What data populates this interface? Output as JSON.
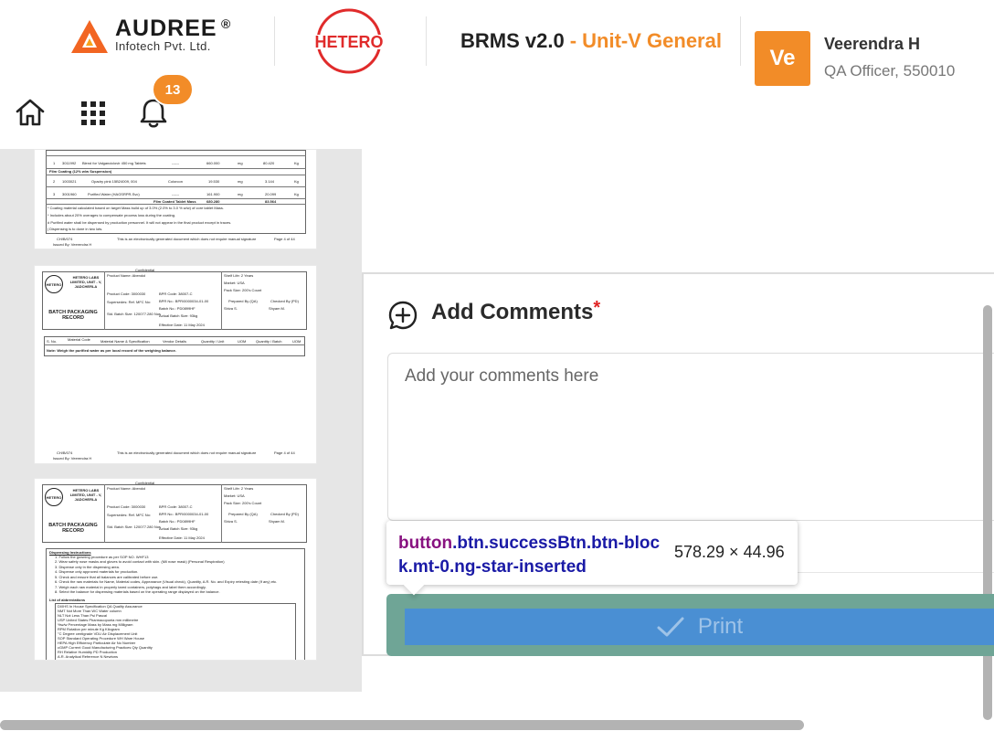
{
  "header": {
    "brand_name": "AUDREE",
    "brand_reg": "®",
    "brand_sub": "Infotech Pvt. Ltd.",
    "hetero_logo_text": "HETERO",
    "app_name": "BRMS v2.0",
    "app_unit": "- Unit-V General",
    "user_initials": "Ve",
    "user_name": "Veerendra H",
    "user_role": "QA Officer, 550010",
    "notification_count": "13",
    "accent_color": "#f28c28"
  },
  "preview": {
    "thumb1": {
      "rows": [
        {
          "sno": "1",
          "code": "3011992",
          "name": "Blend for Valganciclovir 450 mg Tablets",
          "vendor": "------",
          "qty": "660.000",
          "uom": "mg",
          "qty_batch": "80.420",
          "unit": "Kg"
        },
        {
          "sno": "2",
          "code": "1003021",
          "name": "Opadry pink 15B24009, 004",
          "vendor": "Colorcon",
          "qty": "19.530",
          "uom": "mg",
          "qty_batch": "3.144",
          "unit": "Kg"
        },
        {
          "sno": "3",
          "code": "3001960",
          "name": "Purified Water (HAGSRPR-Svc)",
          "vendor": "------",
          "qty": "161.900",
          "uom": "mg",
          "qty_batch": "20.099",
          "unit": "Kg"
        }
      ],
      "section": "Film Coating (12% w/w Suspension)",
      "total_label": "Film Coated Tablet Mass",
      "total_value": "680.280",
      "total_batch": "83.564",
      "notes": [
        "* Coating material calculated based on target Mass build up of 3.0% (2.0% to 3.0 % w/w) of core tablet Mass.",
        "* Includes about 20% overages to compensate process loss during the coating.",
        "# Purified water shall be dispensed by production personnel. It will not appear in the final product except in traces.",
        "| Dispensing is to done in two lots."
      ],
      "footer_left": "Issued By: Veerendra H",
      "footer_mid": "This is an electronically generated document which does not require manual signature",
      "footer_right": "Page 4 of 44",
      "footer_code": "CH/B/074"
    },
    "doc_header": {
      "confidential": "Confidential",
      "company": "HETERO LABS LIMITED, UNIT - V, JADCHERLA",
      "logo": "HETERO",
      "product_name": "Product Name: Abendol",
      "product_code": "Product Code: 3000030",
      "supersedes": "Supersedes: Ref. MFC No:",
      "batch_size": "Std. Batch Size: 120077.280 Nos",
      "bpr_code": "BPR Code: 38007-C",
      "bpr_no": "BPR No.: BPR/0000034-01-00",
      "batch_no": "Batch No.: PD0899HF",
      "actual_batch": "Actual Batch Size: 93kg",
      "shelf_life": "Shelf Life: 2 Years",
      "market": "Market: USA",
      "pack": "Pack Size: 200's Count",
      "title": "BATCH PACKAGING RECORD",
      "prepared": "Prepared By (QA)",
      "checked": "Checked By (PD)",
      "prepared_name": "Shiva S.",
      "checked_name": "Shyam M.",
      "effective": "Effective Date: 11 May 2024"
    },
    "thumb2": {
      "columns": [
        "S. No.",
        "Material Code",
        "Material Name & Specification",
        "Vendor Details",
        "Quantity / Unit",
        "UOM",
        "Quantity / Batch",
        "UOM"
      ],
      "note": "Note: Weigh the purified water as per local record of the weighing balance."
    },
    "thumb3": {
      "section": "Dispensing Instructions",
      "steps": [
        "1. Follow the gowning procedure as per SOP NO. WHF13",
        "2. Wear safety nose masks and gloves to avoid contact with skin. (Mil nose mask) (Personal Respiration)",
        "3. Dispense only in the dispensing area.",
        "4. Dispense only approved materials for production.",
        "5. Check and ensure that all balances are calibrated before use.",
        "6. Check the raw materials for Name, Material codes, Appearance (Visual check), Quantity, A.R. No. and Expiry retesting date (If any) etc.",
        "7. Weigh each raw material in properly tared containers, polybags and label them accordingly.",
        "8. Select the balance for dispensing materials based on the operating range displayed on the balance."
      ],
      "abbr_title": "List of abbreviations",
      "abbreviations": [
        "DI/IHS  In House Specification  QA  Quality Assurance",
        "NMT  Not More Than  WC  Water column",
        "NLT  Not Less Than  Psi  Pascal",
        "USP  United States Pharmacopoeia  mm  millimetre",
        "%w/w  Percentage Mass by Mass  mg  Milligram",
        "RPM  Rotation per minute  Kg  Kilogram",
        "°C  Degree centigrade  VDU  Air Displacement Unit",
        "SOP  Standard Operating Procedure  WH  Ware House",
        "HEPA  High Efficiency Particulate Air  No  Number",
        "cGMP  Current Good Manufacturing Practices  Qty  Quantity",
        "RH  Relative Humidity  PD  Production",
        "A.R.  Analytical Reference  N  Newtons"
      ]
    }
  },
  "comments": {
    "title": "Add Comments",
    "required_mark": "*",
    "placeholder": "Add your comments here"
  },
  "inspector": {
    "tag": "button",
    "classes": ".btn.successBtn.btn-block.mt-0.ng-star-inserted",
    "size": "578.29 × 44.96"
  },
  "actions": {
    "print_label": "Print",
    "print_color": "#4a8fd3"
  }
}
